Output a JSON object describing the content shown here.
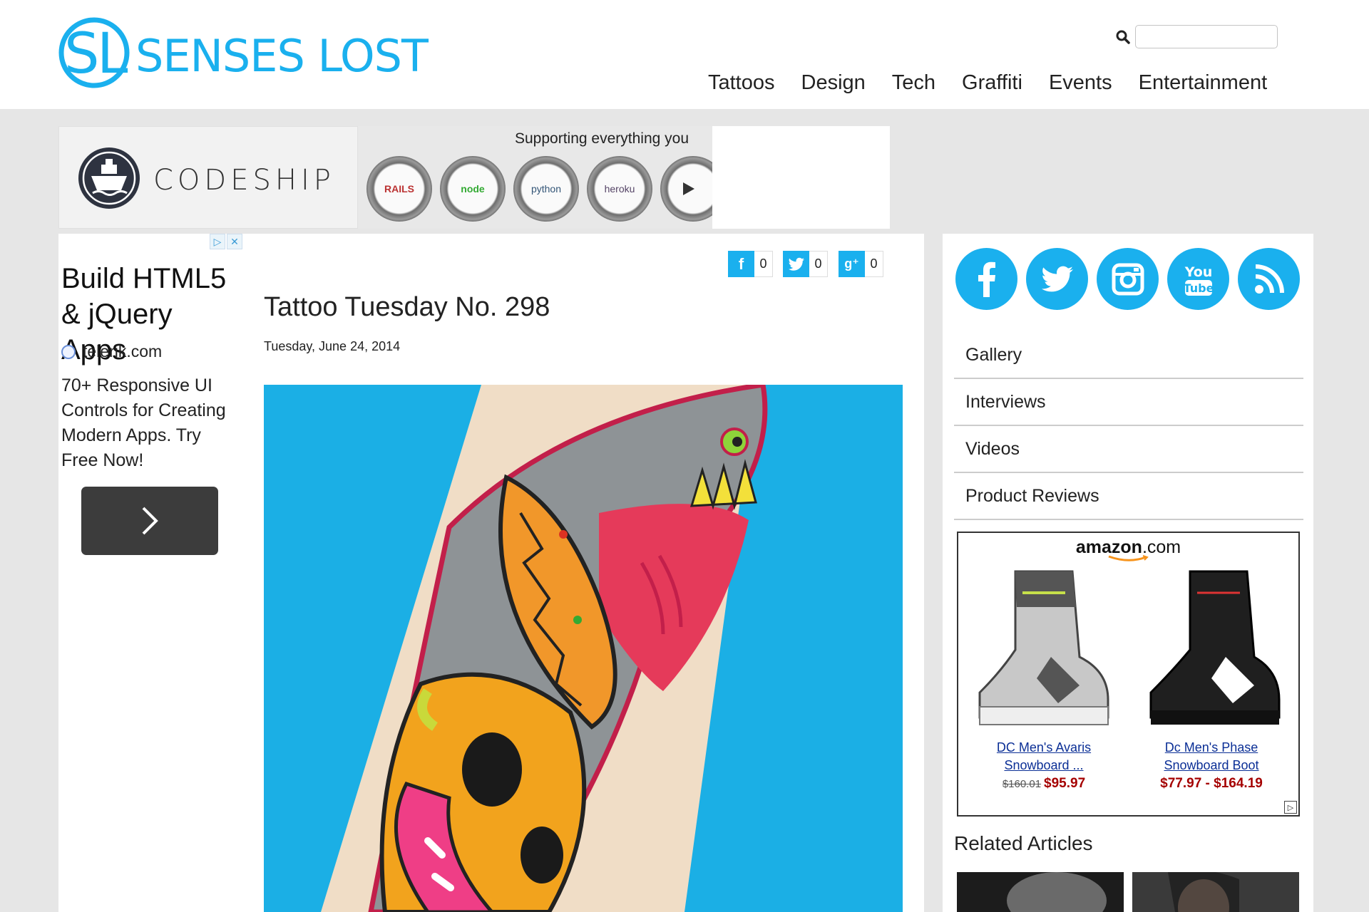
{
  "site": {
    "logo_text": "SENSES LOST",
    "accent_color": "#1ab0ee"
  },
  "search": {
    "placeholder": ""
  },
  "nav": [
    "Tattoos",
    "Design",
    "Tech",
    "Graffiti",
    "Events",
    "Entertainment"
  ],
  "banner_ad": {
    "brand": "CODESHIP",
    "tagline": "Supporting everything you",
    "tech_labels": [
      "RAILS",
      "node",
      "python",
      "heroku",
      ""
    ]
  },
  "left_ad": {
    "title": "Build HTML5 & jQuery Apps",
    "domain": "telerik.com",
    "body": "70+ Responsive UI Controls for Creating Modern Apps. Try Free Now!"
  },
  "share": {
    "facebook_count": "0",
    "twitter_count": "0",
    "gplus_count": "0"
  },
  "article": {
    "title": "Tattoo Tuesday No. 298",
    "date": "Tuesday, June 24, 2014"
  },
  "sidebar": {
    "social_icons": [
      "facebook-icon",
      "twitter-icon",
      "instagram-icon",
      "youtube-icon",
      "rss-icon"
    ],
    "menu": [
      "Gallery",
      "Interviews",
      "Videos",
      "Product Reviews"
    ],
    "amazon": {
      "logo": "amazon",
      "logo_suffix": ".com",
      "products": [
        {
          "name": "DC Men's Avaris Snowboard ...",
          "old_price": "$160.01",
          "price": "$95.97"
        },
        {
          "name": "Dc Men's Phase Snowboard Boot",
          "old_price": "",
          "price": "$77.97 - $164.19"
        }
      ]
    },
    "related_title": "Related Articles"
  }
}
